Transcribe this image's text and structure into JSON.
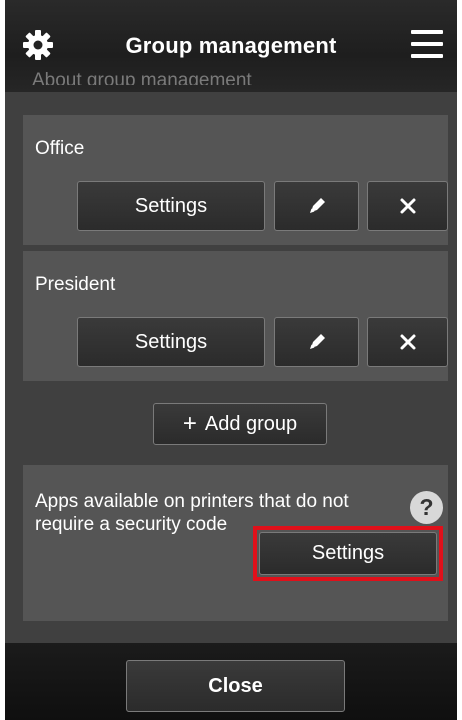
{
  "header": {
    "title": "Group management",
    "settings_icon": "gear-icon",
    "menu_icon": "hamburger-menu-icon"
  },
  "about_link": "About group management",
  "groups": [
    {
      "name": "Office",
      "settings_label": "Settings",
      "edit_icon": "pencil-icon",
      "delete_icon": "close-icon"
    },
    {
      "name": "President",
      "settings_label": "Settings",
      "edit_icon": "pencil-icon",
      "delete_icon": "close-icon"
    }
  ],
  "add_group": {
    "symbol": "+",
    "label": "Add group"
  },
  "security_section": {
    "text": "Apps available on printers that do not require a security code",
    "help_symbol": "?",
    "settings_label": "Settings",
    "highlight_color": "#e0101a"
  },
  "footer": {
    "close_label": "Close"
  },
  "colors": {
    "background": "#404040",
    "panel": "#555555",
    "header": "#1e1e1e",
    "button": "#2b2b2b",
    "text": "#ffffff"
  }
}
